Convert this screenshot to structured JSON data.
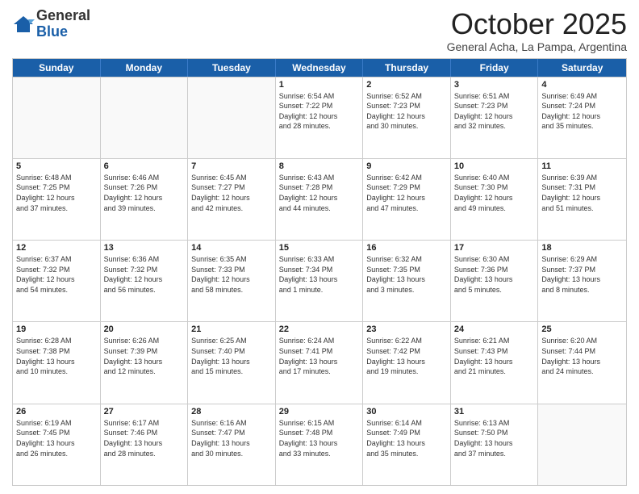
{
  "header": {
    "logo_general": "General",
    "logo_blue": "Blue",
    "month_title": "October 2025",
    "location": "General Acha, La Pampa, Argentina"
  },
  "days_of_week": [
    "Sunday",
    "Monday",
    "Tuesday",
    "Wednesday",
    "Thursday",
    "Friday",
    "Saturday"
  ],
  "weeks": [
    [
      {
        "day": "",
        "info": ""
      },
      {
        "day": "",
        "info": ""
      },
      {
        "day": "",
        "info": ""
      },
      {
        "day": "1",
        "info": "Sunrise: 6:54 AM\nSunset: 7:22 PM\nDaylight: 12 hours\nand 28 minutes."
      },
      {
        "day": "2",
        "info": "Sunrise: 6:52 AM\nSunset: 7:23 PM\nDaylight: 12 hours\nand 30 minutes."
      },
      {
        "day": "3",
        "info": "Sunrise: 6:51 AM\nSunset: 7:23 PM\nDaylight: 12 hours\nand 32 minutes."
      },
      {
        "day": "4",
        "info": "Sunrise: 6:49 AM\nSunset: 7:24 PM\nDaylight: 12 hours\nand 35 minutes."
      }
    ],
    [
      {
        "day": "5",
        "info": "Sunrise: 6:48 AM\nSunset: 7:25 PM\nDaylight: 12 hours\nand 37 minutes."
      },
      {
        "day": "6",
        "info": "Sunrise: 6:46 AM\nSunset: 7:26 PM\nDaylight: 12 hours\nand 39 minutes."
      },
      {
        "day": "7",
        "info": "Sunrise: 6:45 AM\nSunset: 7:27 PM\nDaylight: 12 hours\nand 42 minutes."
      },
      {
        "day": "8",
        "info": "Sunrise: 6:43 AM\nSunset: 7:28 PM\nDaylight: 12 hours\nand 44 minutes."
      },
      {
        "day": "9",
        "info": "Sunrise: 6:42 AM\nSunset: 7:29 PM\nDaylight: 12 hours\nand 47 minutes."
      },
      {
        "day": "10",
        "info": "Sunrise: 6:40 AM\nSunset: 7:30 PM\nDaylight: 12 hours\nand 49 minutes."
      },
      {
        "day": "11",
        "info": "Sunrise: 6:39 AM\nSunset: 7:31 PM\nDaylight: 12 hours\nand 51 minutes."
      }
    ],
    [
      {
        "day": "12",
        "info": "Sunrise: 6:37 AM\nSunset: 7:32 PM\nDaylight: 12 hours\nand 54 minutes."
      },
      {
        "day": "13",
        "info": "Sunrise: 6:36 AM\nSunset: 7:32 PM\nDaylight: 12 hours\nand 56 minutes."
      },
      {
        "day": "14",
        "info": "Sunrise: 6:35 AM\nSunset: 7:33 PM\nDaylight: 12 hours\nand 58 minutes."
      },
      {
        "day": "15",
        "info": "Sunrise: 6:33 AM\nSunset: 7:34 PM\nDaylight: 13 hours\nand 1 minute."
      },
      {
        "day": "16",
        "info": "Sunrise: 6:32 AM\nSunset: 7:35 PM\nDaylight: 13 hours\nand 3 minutes."
      },
      {
        "day": "17",
        "info": "Sunrise: 6:30 AM\nSunset: 7:36 PM\nDaylight: 13 hours\nand 5 minutes."
      },
      {
        "day": "18",
        "info": "Sunrise: 6:29 AM\nSunset: 7:37 PM\nDaylight: 13 hours\nand 8 minutes."
      }
    ],
    [
      {
        "day": "19",
        "info": "Sunrise: 6:28 AM\nSunset: 7:38 PM\nDaylight: 13 hours\nand 10 minutes."
      },
      {
        "day": "20",
        "info": "Sunrise: 6:26 AM\nSunset: 7:39 PM\nDaylight: 13 hours\nand 12 minutes."
      },
      {
        "day": "21",
        "info": "Sunrise: 6:25 AM\nSunset: 7:40 PM\nDaylight: 13 hours\nand 15 minutes."
      },
      {
        "day": "22",
        "info": "Sunrise: 6:24 AM\nSunset: 7:41 PM\nDaylight: 13 hours\nand 17 minutes."
      },
      {
        "day": "23",
        "info": "Sunrise: 6:22 AM\nSunset: 7:42 PM\nDaylight: 13 hours\nand 19 minutes."
      },
      {
        "day": "24",
        "info": "Sunrise: 6:21 AM\nSunset: 7:43 PM\nDaylight: 13 hours\nand 21 minutes."
      },
      {
        "day": "25",
        "info": "Sunrise: 6:20 AM\nSunset: 7:44 PM\nDaylight: 13 hours\nand 24 minutes."
      }
    ],
    [
      {
        "day": "26",
        "info": "Sunrise: 6:19 AM\nSunset: 7:45 PM\nDaylight: 13 hours\nand 26 minutes."
      },
      {
        "day": "27",
        "info": "Sunrise: 6:17 AM\nSunset: 7:46 PM\nDaylight: 13 hours\nand 28 minutes."
      },
      {
        "day": "28",
        "info": "Sunrise: 6:16 AM\nSunset: 7:47 PM\nDaylight: 13 hours\nand 30 minutes."
      },
      {
        "day": "29",
        "info": "Sunrise: 6:15 AM\nSunset: 7:48 PM\nDaylight: 13 hours\nand 33 minutes."
      },
      {
        "day": "30",
        "info": "Sunrise: 6:14 AM\nSunset: 7:49 PM\nDaylight: 13 hours\nand 35 minutes."
      },
      {
        "day": "31",
        "info": "Sunrise: 6:13 AM\nSunset: 7:50 PM\nDaylight: 13 hours\nand 37 minutes."
      },
      {
        "day": "",
        "info": ""
      }
    ]
  ]
}
